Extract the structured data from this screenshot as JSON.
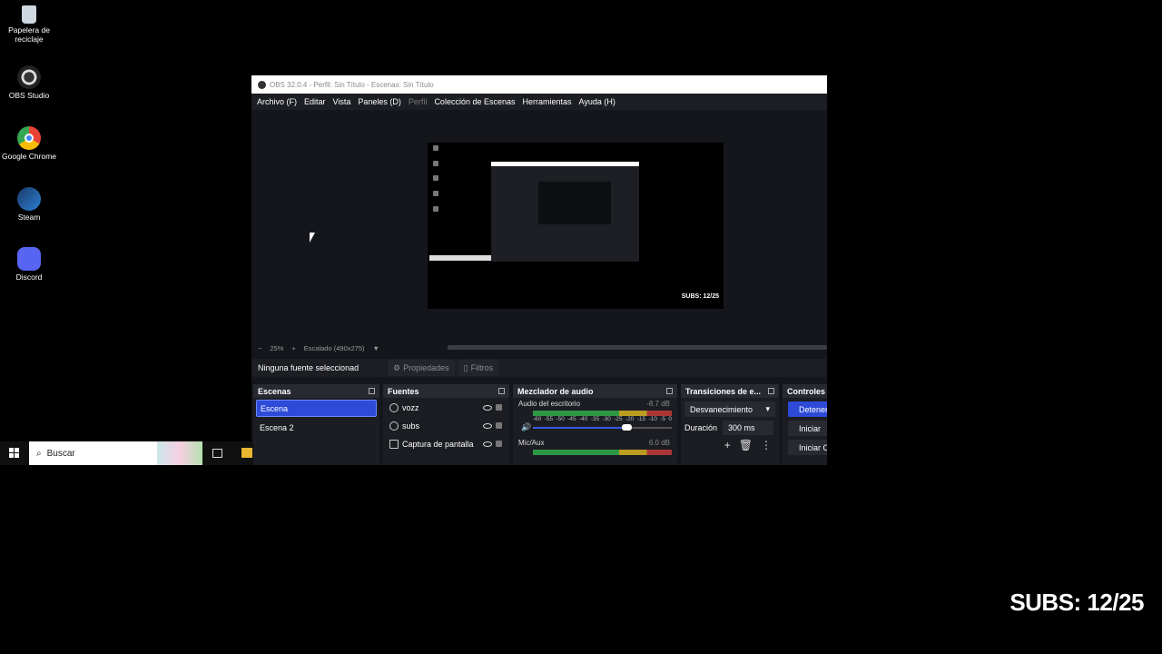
{
  "desktop": {
    "icons": [
      {
        "label": "Papelera de reciclaje",
        "icon": "recycle-bin-icon"
      },
      {
        "label": "OBS Studio",
        "icon": "obs-icon"
      },
      {
        "label": "Google Chrome",
        "icon": "chrome-icon"
      },
      {
        "label": "Steam",
        "icon": "steam-icon"
      },
      {
        "label": "Discord",
        "icon": "discord-icon"
      }
    ]
  },
  "obs": {
    "title": "OBS 32.0.4 - Perfil: Sin Título - Escenas: Sin Título",
    "menu": [
      "Archivo (F)",
      "Editar",
      "Vista",
      "Paneles (D)",
      "Perfil",
      "Colección de Escenas",
      "Herramientas",
      "Ayuda (H)"
    ],
    "preview": {
      "subs_overlay": "SUBS: 12/25"
    },
    "zoom": {
      "minus": "−",
      "value": "25%",
      "plus": "+",
      "scale_label": "Escalado (490x275)"
    },
    "source_bar": {
      "none_selected": "Ninguna fuente seleccionad",
      "properties": "Propiedades",
      "filters": "Filtros"
    },
    "scenes": {
      "title": "Escenas",
      "items": [
        "Escena",
        "Escena 2"
      ],
      "active_index": 0
    },
    "sources": {
      "title": "Fuentes",
      "items": [
        "vozz",
        "subs",
        "Captura de pantalla"
      ]
    },
    "mixer": {
      "title": "Mezclador de audio",
      "channels": [
        {
          "name": "Audio del escritorio",
          "db": "-8.7 dB",
          "scale": [
            "-60",
            "-55",
            "-50",
            "-45",
            "-40",
            "-35",
            "-30",
            "-25",
            "-20",
            "-15",
            "-10",
            "-5",
            "0"
          ],
          "volume": 0.77
        },
        {
          "name": "Mic/Aux",
          "db": "6.0 dB"
        }
      ]
    },
    "transitions": {
      "title": "Transiciones de e...",
      "selected": "Desvanecimiento",
      "duration_label": "Duración",
      "duration_value": "300 ms"
    },
    "controls": {
      "title": "Controles",
      "buttons": [
        "Detener",
        "Iniciar",
        "Iniciar Cámara"
      ]
    }
  },
  "taskbar": {
    "search_placeholder": "Buscar"
  },
  "stream_overlay": {
    "subs_text": "SUBS: 12/25"
  },
  "colors": {
    "accent": "#2d4ad8",
    "window_bg": "#14161b",
    "dock_bg": "#1b1d23"
  }
}
